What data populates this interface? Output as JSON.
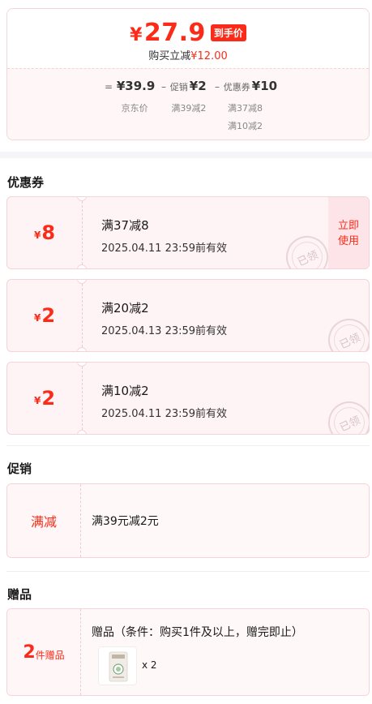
{
  "summary": {
    "currency": "¥",
    "final_price": "27.9",
    "final_tag": "到手价",
    "instant_cut_label": "购买立减",
    "instant_cut_value": "¥12.00",
    "formula": [
      {
        "op": "=",
        "label": "",
        "value": "¥39.9",
        "sub": [
          "京东价"
        ]
      },
      {
        "op": "–",
        "label": "促销",
        "value": "¥2",
        "sub": [
          "满39减2"
        ]
      },
      {
        "op": "–",
        "label": "优惠券",
        "value": "¥10",
        "sub": [
          "满37减8",
          "满10减2"
        ]
      }
    ]
  },
  "coupons_section": {
    "title": "优惠券",
    "coupons": [
      {
        "currency": "¥",
        "amount": "8",
        "condition": "满37减8",
        "expire": "2025.04.11 23:59前有效",
        "action": [
          "立即",
          "使用"
        ],
        "stamp": "已领"
      },
      {
        "currency": "¥",
        "amount": "2",
        "condition": "满20减2",
        "expire": "2025.04.13 23:59前有效",
        "stamp": "已领"
      },
      {
        "currency": "¥",
        "amount": "2",
        "condition": "满10减2",
        "expire": "2025.04.11 23:59前有效",
        "stamp": "已领"
      }
    ]
  },
  "promo_section": {
    "title": "促销",
    "type": "满减",
    "detail": "满39元减2元"
  },
  "gift_section": {
    "title": "赠品",
    "count": "2",
    "unit": "件赠品",
    "desc": "赠品（条件：购买1件及以上，赠完即止）",
    "qty": "x 2"
  },
  "colors": {
    "accent": "#fa2c19",
    "card_bg": "#fef3f5",
    "border": "#f6d3d9"
  }
}
